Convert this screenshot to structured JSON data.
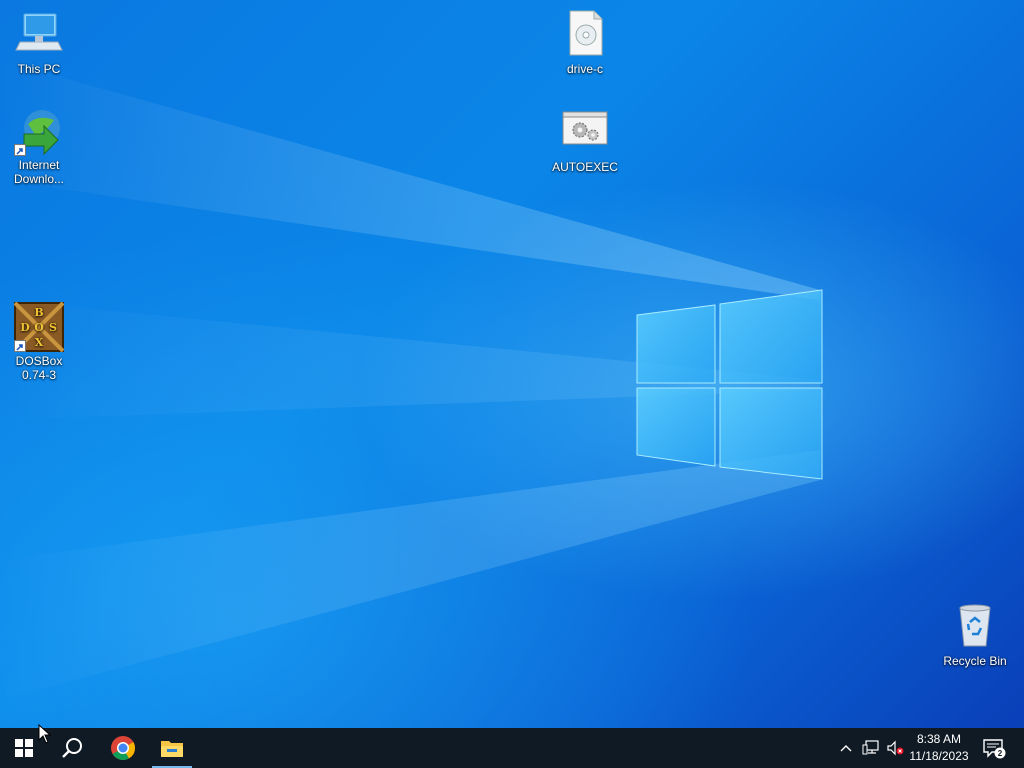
{
  "desktop": {
    "icons": [
      {
        "label": "This PC"
      },
      {
        "label": "Internet Downlo..."
      },
      {
        "label": "DOSBox 0.74-3"
      },
      {
        "label": "drive-c"
      },
      {
        "label": "AUTOEXEC"
      },
      {
        "label": "Recycle Bin"
      }
    ],
    "dosbox_logo_letters": [
      "B",
      "D",
      "O",
      "S",
      "X"
    ]
  },
  "taskbar": {
    "apps": [
      {
        "name": "start-icon"
      },
      {
        "name": "search-icon"
      },
      {
        "name": "chrome-icon"
      },
      {
        "name": "file-explorer-icon"
      }
    ],
    "clock": {
      "time": "8:38 AM",
      "date": "11/18/2023"
    },
    "notifications": {
      "count": "2"
    }
  },
  "colors": {
    "taskbar_bg": "#0f1a24",
    "accent": "#76b9ed",
    "wallpaper_blue": "#0a78e0"
  }
}
